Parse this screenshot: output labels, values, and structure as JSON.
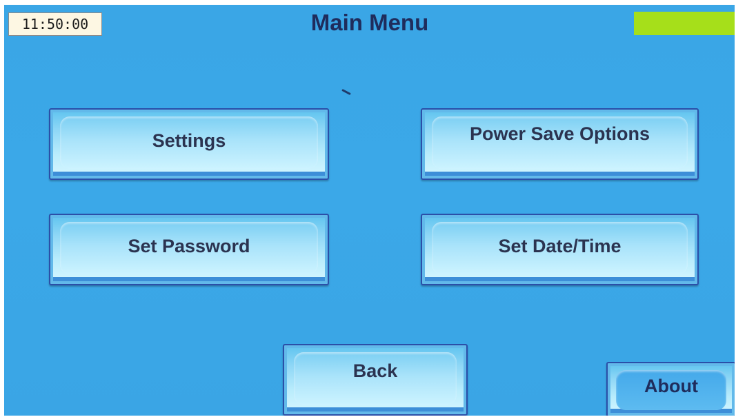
{
  "status_bar": {
    "time": "11:50:00",
    "title": "Main Menu",
    "battery_color": "#a6df1a"
  },
  "menu": {
    "settings_label": "Settings",
    "power_save_label": "Power Save Options",
    "set_password_label": "Set Password",
    "set_datetime_label": "Set Date/Time",
    "back_label": "Back",
    "about_label": "About"
  },
  "colors": {
    "background": "#3aa6e6",
    "button_border": "#2b4fa8",
    "title_text": "#1f2c5c"
  }
}
